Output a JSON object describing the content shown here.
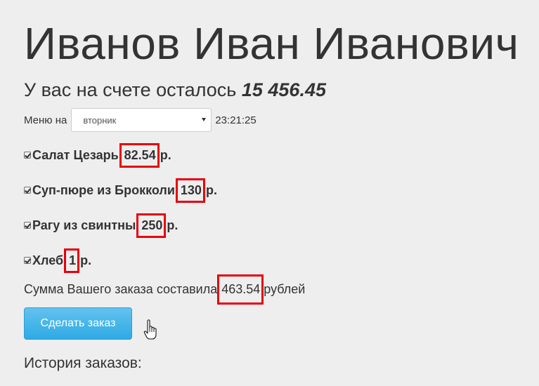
{
  "user": {
    "name": "Иванов Иван Иванович"
  },
  "balance": {
    "label": "У вас на счете осталось",
    "amount": "15 456.45"
  },
  "menu": {
    "label": "Меню на",
    "selected_day": "вторник",
    "time": "23:21:25"
  },
  "dishes": [
    {
      "name": "Салат Цезарь",
      "price": "82.54",
      "currency": "р.",
      "checked": true
    },
    {
      "name": "Суп-пюре из Брокколи",
      "price": "130",
      "currency": "р.",
      "checked": true
    },
    {
      "name": "Рагу из свинтны",
      "price": "250",
      "currency": "р.",
      "checked": true
    },
    {
      "name": "Хлеб",
      "price": "1",
      "currency": "р.",
      "checked": true
    }
  ],
  "order_sum": {
    "label": "Сумма Вашего заказа составила",
    "amount": "463.54",
    "suffix": "рублей"
  },
  "order_button": {
    "label": "Сделать заказ"
  },
  "history": {
    "title": "История заказов:"
  },
  "colors": {
    "highlight": "#e8000c",
    "button": "#2eaae4",
    "background": "#eeeeee"
  }
}
